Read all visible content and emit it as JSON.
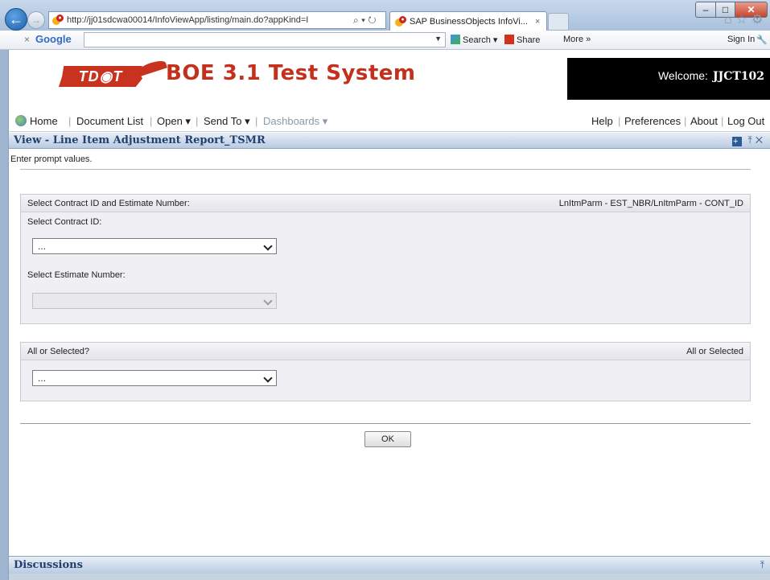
{
  "browser": {
    "address_url": "http://jj01sdcwa00014/InfoViewApp/listing/main.do?appKind=I",
    "tab_title": "SAP BusinessObjects InfoVi...",
    "tab_close": "×"
  },
  "google_toolbar": {
    "close": "×",
    "logo": "Google",
    "search": "Search",
    "share": "Share",
    "more": "More »",
    "sign_in": "Sign In"
  },
  "header": {
    "logo_text": "TD◉T",
    "title": "BOE 3.1 Test System",
    "welcome_label": "Welcome:",
    "username": "JJCT102"
  },
  "menu": {
    "home": "Home",
    "document_list": "Document List",
    "open": "Open ▾",
    "send_to": "Send To ▾",
    "dashboards": "Dashboards ▾",
    "help": "Help",
    "preferences": "Preferences",
    "about": "About",
    "log_out": "Log Out"
  },
  "view": {
    "title": "View - Line Item Adjustment Report_TSMR",
    "prompt_hint": "Enter prompt values.",
    "panel1": {
      "title": "Select Contract ID and Estimate Number:",
      "param": "LnItmParm - EST_NBR/LnItmParm - CONT_ID",
      "contract_label": "Select Contract ID:",
      "contract_value": "...",
      "estimate_label": "Select Estimate Number:",
      "estimate_value": ""
    },
    "panel2": {
      "title": "All or Selected?",
      "param": "All or Selected",
      "value": "..."
    },
    "ok_label": "OK"
  },
  "discussions": {
    "title": "Discussions"
  }
}
